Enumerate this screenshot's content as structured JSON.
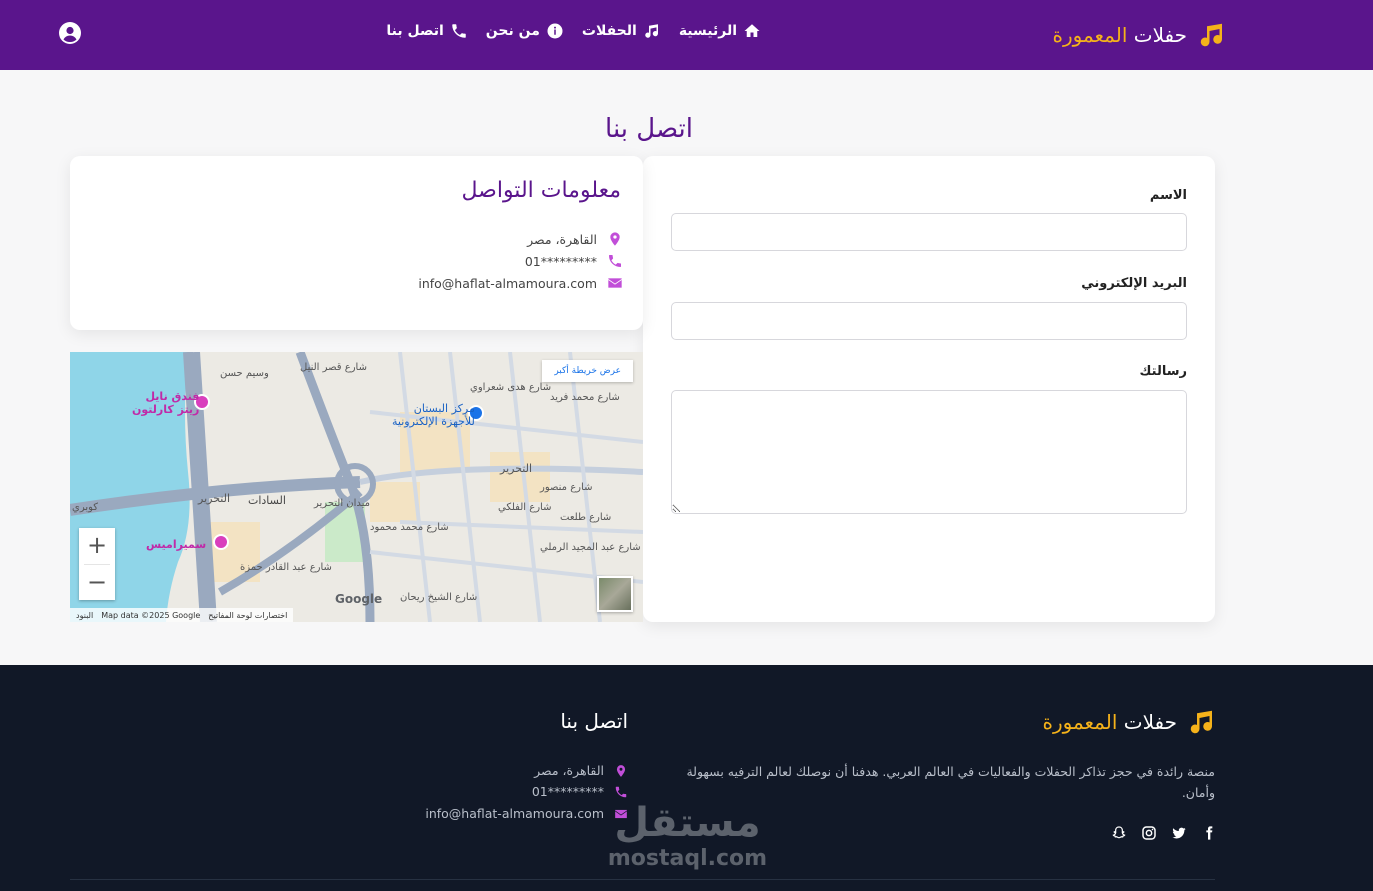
{
  "header": {
    "brand_main": "حفلات",
    "brand_accent": "المعمورة",
    "nav": [
      {
        "label": "الرئيسية",
        "icon": "home-icon"
      },
      {
        "label": "الحفلات",
        "icon": "music-icon"
      },
      {
        "label": "من نحن",
        "icon": "info-icon"
      },
      {
        "label": "اتصل بنا",
        "icon": "phone-icon"
      }
    ],
    "user_icon": "user-circle-icon"
  },
  "page": {
    "title": "اتصل بنا"
  },
  "form": {
    "name_label": "الاسم",
    "name_value": "",
    "email_label": "البريد الإلكتروني",
    "email_value": "",
    "message_label": "رسالتك",
    "message_value": ""
  },
  "info": {
    "title": "معلومات التواصل",
    "address": "القاهرة، مصر",
    "phone": "01*********",
    "email": "info@haflat-almamoura.com"
  },
  "map": {
    "larger_map": "عرض خريطة أكبر",
    "zoom_in": "+",
    "zoom_out": "−",
    "shortcuts": "اختصارات لوحة المفاتيح",
    "map_data": "Map data ©2025 Google",
    "terms": "البنود",
    "google": "Google",
    "labels": {
      "hotel1_line1": "فندق نايل",
      "hotel1_line2": "ريتز كارلتون",
      "mall_line1": "مركز البستان",
      "mall_line2": "للأجهزة الإلكترونية",
      "hotel2": "سميراميس",
      "sadat": "السادات",
      "tahrir": "التحرير",
      "tahrir2": "التحرير",
      "street_sherif": "شارع هدى شعراوي",
      "street_mohamed_mahmoud": "شارع محمد محمود",
      "street_sheikh_rihan": "شارع الشيخ ريحان",
      "street_falaki": "شارع الفلكي",
      "street_abdelaziz": "شارع عبد المجيد الرملي",
      "street_qasr": "شارع قصر النيل",
      "street_top": "وسيم حسن",
      "street_mansour": "شارع منصور",
      "street_abdel_qader": "شارع عبد القادر حمزة",
      "street_mohamed_farid": "شارع محمد فريد",
      "street_talaat": "شارع طلعت",
      "kotsika": "كوبري",
      "square": "ميدان التحرير"
    }
  },
  "footer": {
    "brand_main": "حفلات",
    "brand_accent": "المعمورة",
    "description": "منصة رائدة في حجز تذاكر الحفلات والفعاليات في العالم العربي. هدفنا أن نوصلك لعالم الترفيه بسهولة وأمان.",
    "contact_title": "اتصل بنا",
    "address": "القاهرة، مصر",
    "phone": "01*********",
    "email": "info@haflat-almamoura.com",
    "socials": [
      "facebook-icon",
      "twitter-icon",
      "instagram-icon",
      "snapchat-icon"
    ]
  },
  "watermark": {
    "arabic": "مستقل",
    "latin": "mostaql.com"
  },
  "colors": {
    "primary": "#5a158c",
    "accent": "#f5b21a",
    "icon_purple": "#c14ed8",
    "footer_bg": "#111827"
  }
}
